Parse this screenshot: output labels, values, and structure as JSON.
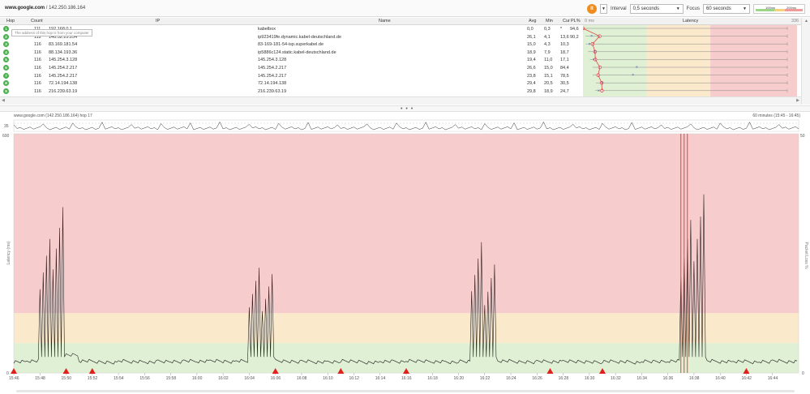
{
  "address": {
    "host": "www.google.com",
    "sep": " / ",
    "ip": "142.250.186.164"
  },
  "controls": {
    "pause_icon": "pause-icon",
    "interval_label": "Interval",
    "interval_value": "0,5 seconds",
    "focus_label": "Focus",
    "focus_value": "60 seconds",
    "scale_100": "100ms",
    "scale_200": "200ms"
  },
  "table": {
    "headers": {
      "hop": "Hop",
      "count": "Count",
      "ip": "IP",
      "name": "Name",
      "avg": "Avg",
      "min": "Min",
      "cur": "Cur",
      "pl": "PL%",
      "latency_zero": "0 ms",
      "latency": "Latency",
      "latency_max": "336"
    },
    "tooltip": "The address of this hop is from your computer",
    "rows": [
      {
        "hop": "1",
        "count": "111",
        "ip": "192.168.0.1",
        "name": "kabelbox",
        "avg": "0,0",
        "min": "0,3",
        "cur": "*",
        "pl": "94,6"
      },
      {
        "hop": "2",
        "count": "112",
        "ip": "146.52.25.254",
        "name": "ip923419fe.dynamic.kabel-deutschland.de",
        "avg": "26,1",
        "min": "4,1",
        "cur": "13,6",
        "pl": "90,2"
      },
      {
        "hop": "3",
        "count": "116",
        "ip": "83.169.181.54",
        "name": "83-169-181-54-isp.superkabel.de",
        "avg": "15,0",
        "min": "4,3",
        "cur": "10,3",
        "pl": ""
      },
      {
        "hop": "4",
        "count": "116",
        "ip": "88.134.193.36",
        "name": "ip5886c124.static.kabel-deutschland.de",
        "avg": "18,9",
        "min": "7,9",
        "cur": "18,7",
        "pl": ""
      },
      {
        "hop": "5",
        "count": "116",
        "ip": "145.254.3.128",
        "name": "145.254.3.128",
        "avg": "19,4",
        "min": "11,0",
        "cur": "17,1",
        "pl": ""
      },
      {
        "hop": "6",
        "count": "116",
        "ip": "145.254.2.217",
        "name": "145.254.2.217",
        "avg": "26,6",
        "min": "15,0",
        "cur": "84,4",
        "pl": ""
      },
      {
        "hop": "7",
        "count": "116",
        "ip": "145.254.2.217",
        "name": "145.254.2.217",
        "avg": "23,8",
        "min": "15,1",
        "cur": "78,5",
        "pl": ""
      },
      {
        "hop": "8",
        "count": "116",
        "ip": "72.14.194.138",
        "name": "72.14.194.138",
        "avg": "29,4",
        "min": "20,5",
        "cur": "30,5",
        "pl": ""
      },
      {
        "hop": "9",
        "count": "116",
        "ip": "216.239.63.19",
        "name": "216.239.63.19",
        "avg": "29,8",
        "min": "18,9",
        "cur": "24,7",
        "pl": ""
      }
    ]
  },
  "splitter_grip": "• • •",
  "timeline": {
    "title": "www.google.com (142.250.186.164) hop 17",
    "range": "60 minutes (15:45 - 16:45)",
    "mini_label": "35",
    "y_axis_title": "Latency (ms)",
    "right_axis_title": "Packet Loss %"
  },
  "colors": {
    "green_zone": "#dff0d4",
    "yellow_zone": "#fbe9cc",
    "red_zone": "#f7cccc",
    "hop_dot": "#4caf50",
    "loss_marker": "#e0201a",
    "accent_orange": "#f08c1e"
  },
  "chart_data": {
    "type": "line",
    "title": "",
    "xlabel": "",
    "ylabel": "Latency (ms)",
    "ylim": [
      0,
      600
    ],
    "zones": [
      {
        "from": 0,
        "to": 75,
        "color": "green"
      },
      {
        "from": 75,
        "to": 150,
        "color": "yellow"
      },
      {
        "from": 150,
        "to": 600,
        "color": "red"
      }
    ],
    "y_ticks": [
      "0",
      "600"
    ],
    "right_y_ticks": [
      "0",
      "50"
    ],
    "x_ticks": [
      "15:46",
      "15:48",
      "15:50",
      "15:52",
      "15:54",
      "15:56",
      "15:58",
      "16:00",
      "16:02",
      "16:04",
      "16:06",
      "16:08",
      "16:10",
      "16:12",
      "16:14",
      "16:16",
      "16:18",
      "16:20",
      "16:22",
      "16:24",
      "16:26",
      "16:28",
      "16:30",
      "16:32",
      "16:34",
      "16:36",
      "16:38",
      "16:40",
      "16:42",
      "16:44"
    ],
    "series": [
      {
        "name": "",
        "x": [
          "15:46",
          "15:47",
          "15:48",
          "15:49",
          "15:50",
          "15:51",
          "15:52",
          "15:53",
          "15:54",
          "15:55",
          "15:56",
          "15:57",
          "15:58",
          "15:59",
          "16:00",
          "16:01",
          "16:02",
          "16:03",
          "16:04",
          "16:05",
          "16:06",
          "16:07",
          "16:08",
          "16:09",
          "16:10",
          "16:11",
          "16:12",
          "16:13",
          "16:14",
          "16:15",
          "16:16",
          "16:17",
          "16:18",
          "16:19",
          "16:20",
          "16:21",
          "16:22",
          "16:23",
          "16:24",
          "16:25",
          "16:26",
          "16:27",
          "16:28",
          "16:29",
          "16:30",
          "16:31",
          "16:32",
          "16:33",
          "16:34",
          "16:35",
          "16:36",
          "16:37",
          "16:38",
          "16:39",
          "16:40",
          "16:41",
          "16:42",
          "16:43",
          "16:44",
          "16:45"
        ],
        "values": [
          28,
          30,
          420,
          520,
          45,
          30,
          28,
          26,
          30,
          28,
          27,
          29,
          28,
          30,
          29,
          31,
          28,
          30,
          330,
          310,
          30,
          28,
          29,
          27,
          28,
          30,
          28,
          26,
          29,
          28,
          30,
          29,
          28,
          27,
          29,
          410,
          340,
          30,
          28,
          27,
          29,
          28,
          30,
          28,
          27,
          29,
          28,
          26,
          29,
          28,
          30,
          480,
          560,
          30,
          28,
          29,
          27,
          28,
          30,
          28
        ]
      }
    ],
    "loss_markers_x": [
      "15:46",
      "15:50",
      "15:52",
      "16:06",
      "16:11",
      "16:16",
      "16:27",
      "16:31",
      "16:42"
    ]
  }
}
